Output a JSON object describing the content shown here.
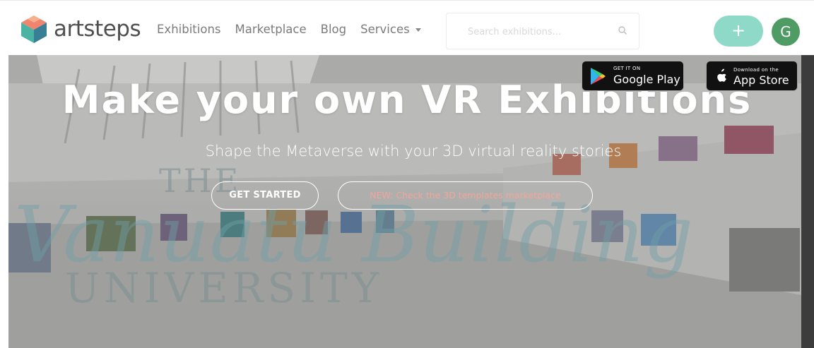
{
  "nav": {
    "logo_text": "artsteps",
    "links": [
      "Exhibitions",
      "Marketplace",
      "Blog",
      "Services"
    ],
    "search_placeholder": "Search exhibitions...",
    "add_label": "+",
    "avatar_letter": "G"
  },
  "hero": {
    "title": "Make your own VR Exhibitions",
    "subtitle": "Shape the Metaverse with your 3D virtual reality stories",
    "get_started_label": "GET STARTED",
    "marketplace_label": "NEW: Check the 3D templates marketplace"
  },
  "badges": {
    "google": {
      "small": "GET IT ON",
      "big": "Google Play"
    },
    "apple": {
      "small": "Download on the",
      "big": "App Store"
    }
  },
  "watermark": {
    "line1": "THE",
    "line2": "Vanuatu Building",
    "line3": "UNIVERSITY"
  },
  "colors": {
    "accent_teal": "#8fd9c8",
    "avatar_green": "#4e9b64",
    "marketplace_text": "#f2a59a"
  }
}
